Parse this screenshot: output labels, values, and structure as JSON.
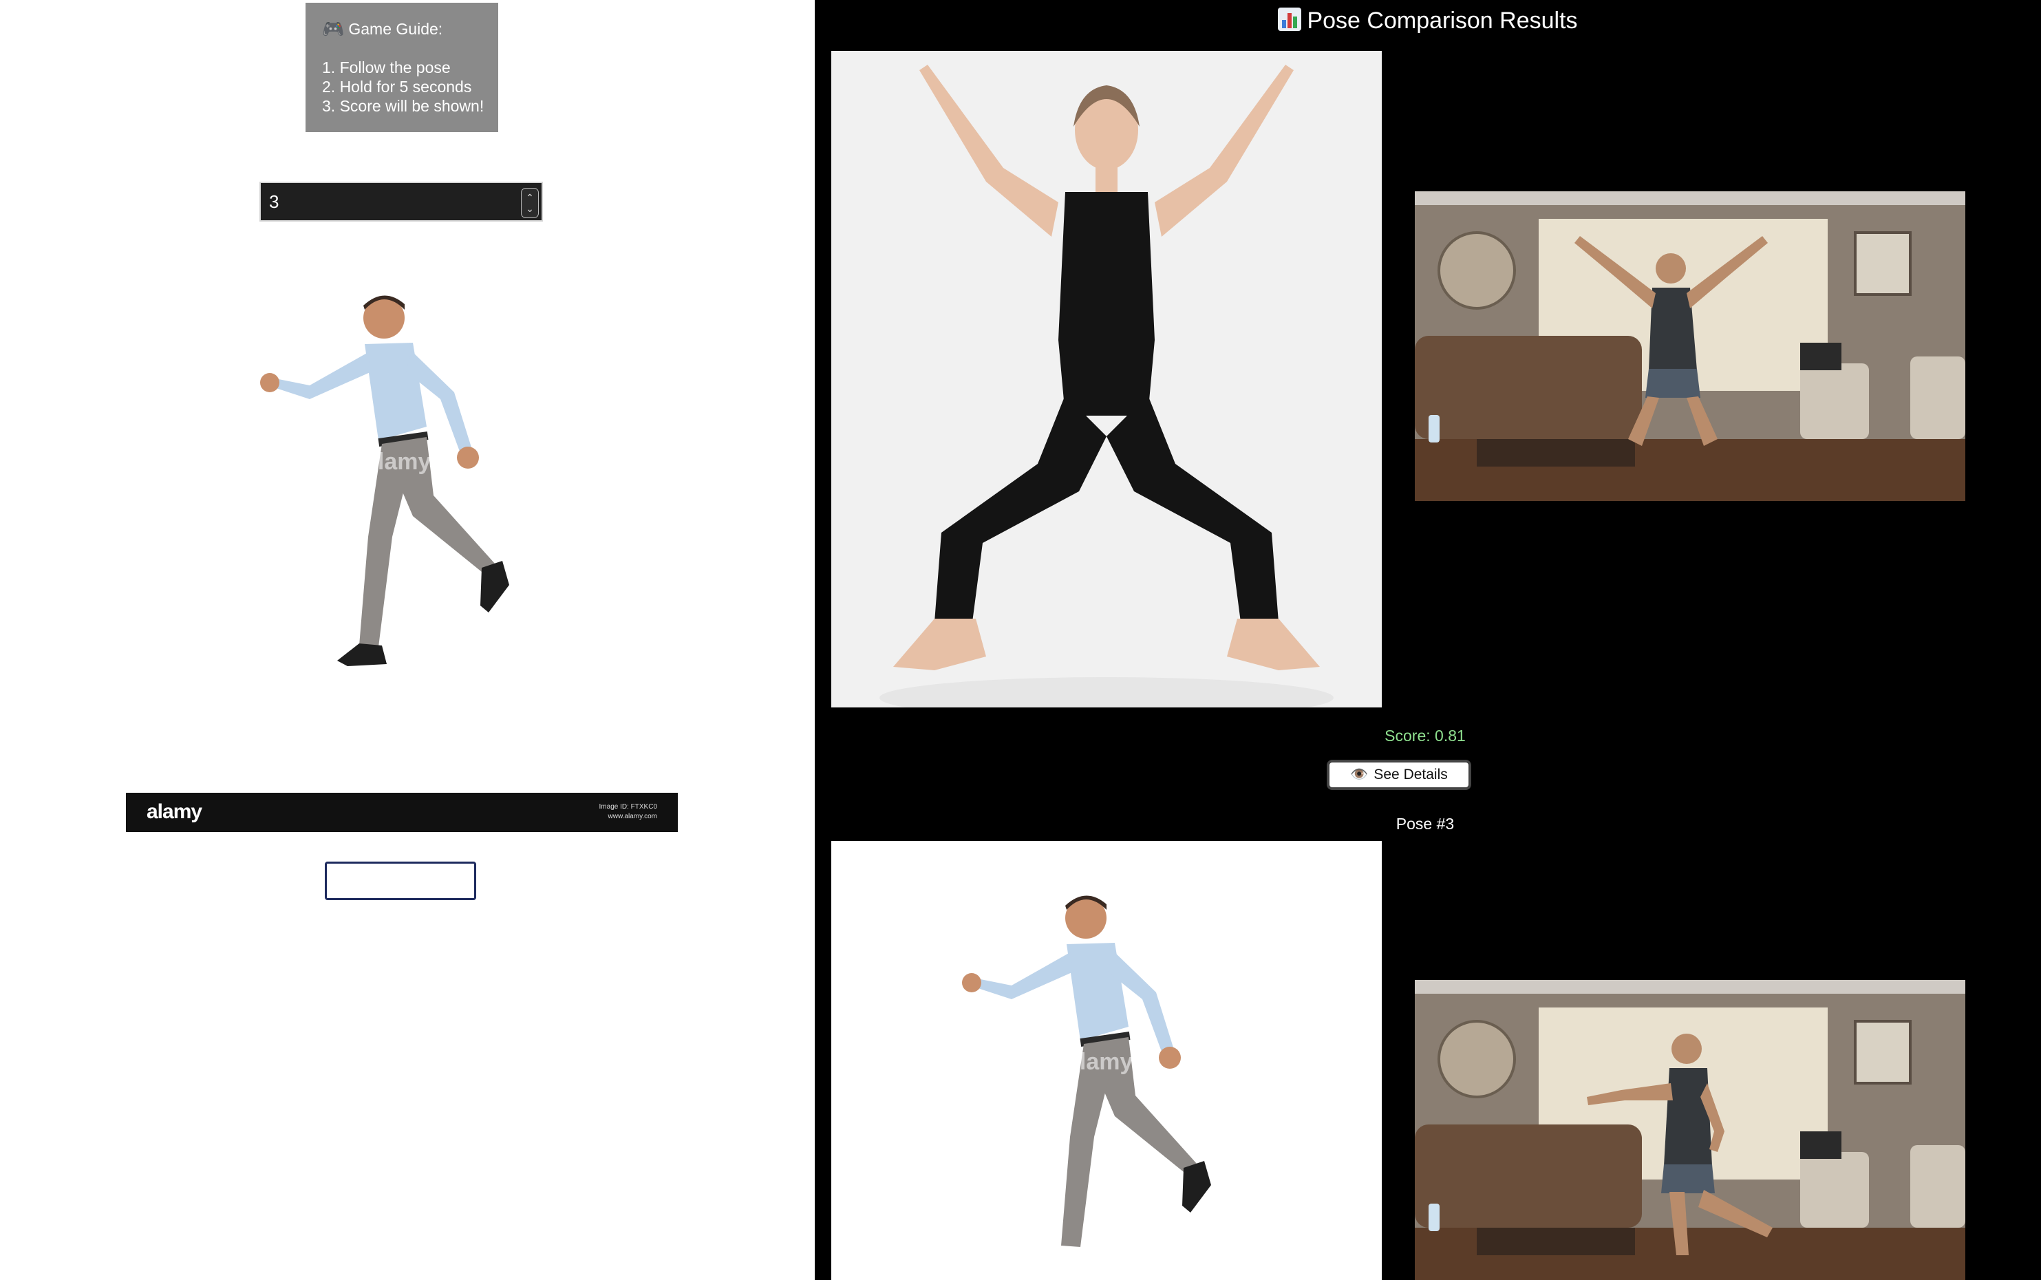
{
  "guide": {
    "icon": "gamepad-icon",
    "title": "Game Guide:",
    "steps": [
      "1. Follow the pose",
      "2. Hold for 5 seconds",
      "3. Score will be shown!"
    ]
  },
  "pose_number_input": {
    "value": "3"
  },
  "watermark": {
    "brand": "alamy",
    "image_id": "Image ID: FTXKC0",
    "site": "www.alamy.com",
    "overlay": "alamy"
  },
  "name_input": {
    "value": ""
  },
  "results": {
    "icon": "bar-chart-icon",
    "title": "Pose Comparison Results",
    "entries": [
      {
        "score_text": "Score: 0.81",
        "details_label": "See Details",
        "details_icon": "eye-icon"
      },
      {
        "pose_label": "Pose #3"
      }
    ]
  },
  "colors": {
    "score": "#8fe08f",
    "panel_dark": "#000000",
    "guide_bg": "#8a8a8a"
  }
}
